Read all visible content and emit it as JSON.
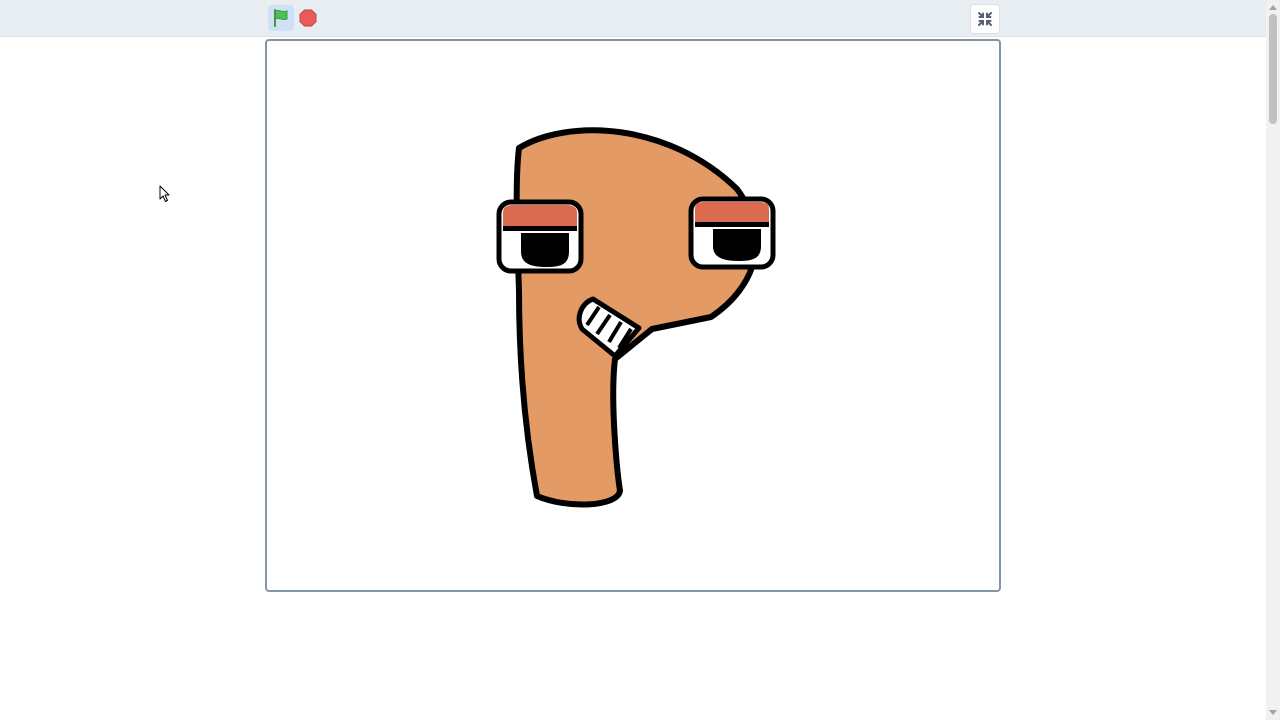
{
  "toolbar": {
    "green_flag": {
      "icon": "green-flag-icon",
      "color": "#4cbf56"
    },
    "stop": {
      "icon": "stop-sign-icon",
      "color": "#ec5959"
    },
    "exit_fullscreen": {
      "icon": "unfullscreen-icon"
    }
  },
  "stage": {
    "sprite": {
      "icon": "letter-p-character",
      "body_color": "#e39a65",
      "eyelid_color": "#da6a50"
    }
  },
  "colors": {
    "header_bg": "#e8edf1",
    "stage_border": "#8595a6"
  }
}
